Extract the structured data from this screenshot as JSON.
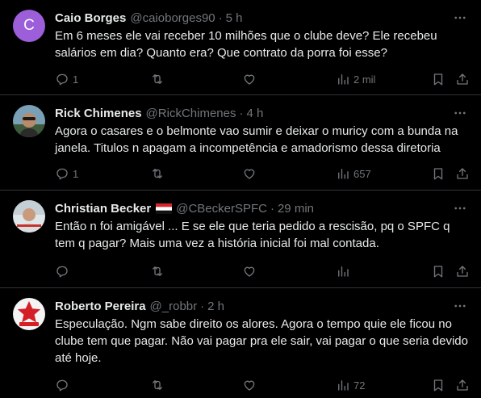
{
  "tweets": [
    {
      "avatar_letter": "C",
      "name": "Caio Borges",
      "handle": "@caioborges90",
      "separator": "·",
      "time": "5 h",
      "text": "Em 6 meses ele vai receber 10 milhões que o clube deve? Ele recebeu salários em dia? Quanto era? Que contrato da porra foi esse?",
      "reply_count": "1",
      "retweet_count": "",
      "like_count": "",
      "views": "2 mil"
    },
    {
      "name": "Rick Chimenes",
      "handle": "@RickChimenes",
      "separator": "·",
      "time": "4 h",
      "text": "Agora o casares e o belmonte vao sumir e deixar o muricy com a bunda na janela. Titulos n apagam a incompetência e amadorismo dessa diretoria",
      "reply_count": "1",
      "retweet_count": "",
      "like_count": "",
      "views": "657"
    },
    {
      "name": "Christian Becker",
      "handle": "@CBeckerSPFC",
      "separator": "·",
      "time": "29 min",
      "text": "Então n foi amigável ... E se ele que teria pedido a rescisão, pq o SPFC q tem q pagar? Mais uma vez a história inicial foi mal contada.",
      "reply_count": "",
      "retweet_count": "",
      "like_count": "",
      "views": ""
    },
    {
      "name": "Roberto Pereira",
      "handle": "@_robbr",
      "separator": "·",
      "time": "2 h",
      "text": "Especulação. Ngm sabe direito os  alores. Agora o tempo quie ele ficou no clube tem que pagar. Não vai pagar pra ele sair, vai pagar o que seria devido até hoje.",
      "reply_count": "",
      "retweet_count": "",
      "like_count": "",
      "views": "72"
    }
  ],
  "colors": {
    "background": "#000000",
    "text": "#e7e9ea",
    "muted": "#71767b",
    "divider": "#2f3336",
    "avatar_purple": "#9c5fd9"
  },
  "icons": [
    "more-icon",
    "reply-icon",
    "retweet-icon",
    "like-icon",
    "views-icon",
    "bookmark-icon",
    "share-icon",
    "flag-icon"
  ]
}
